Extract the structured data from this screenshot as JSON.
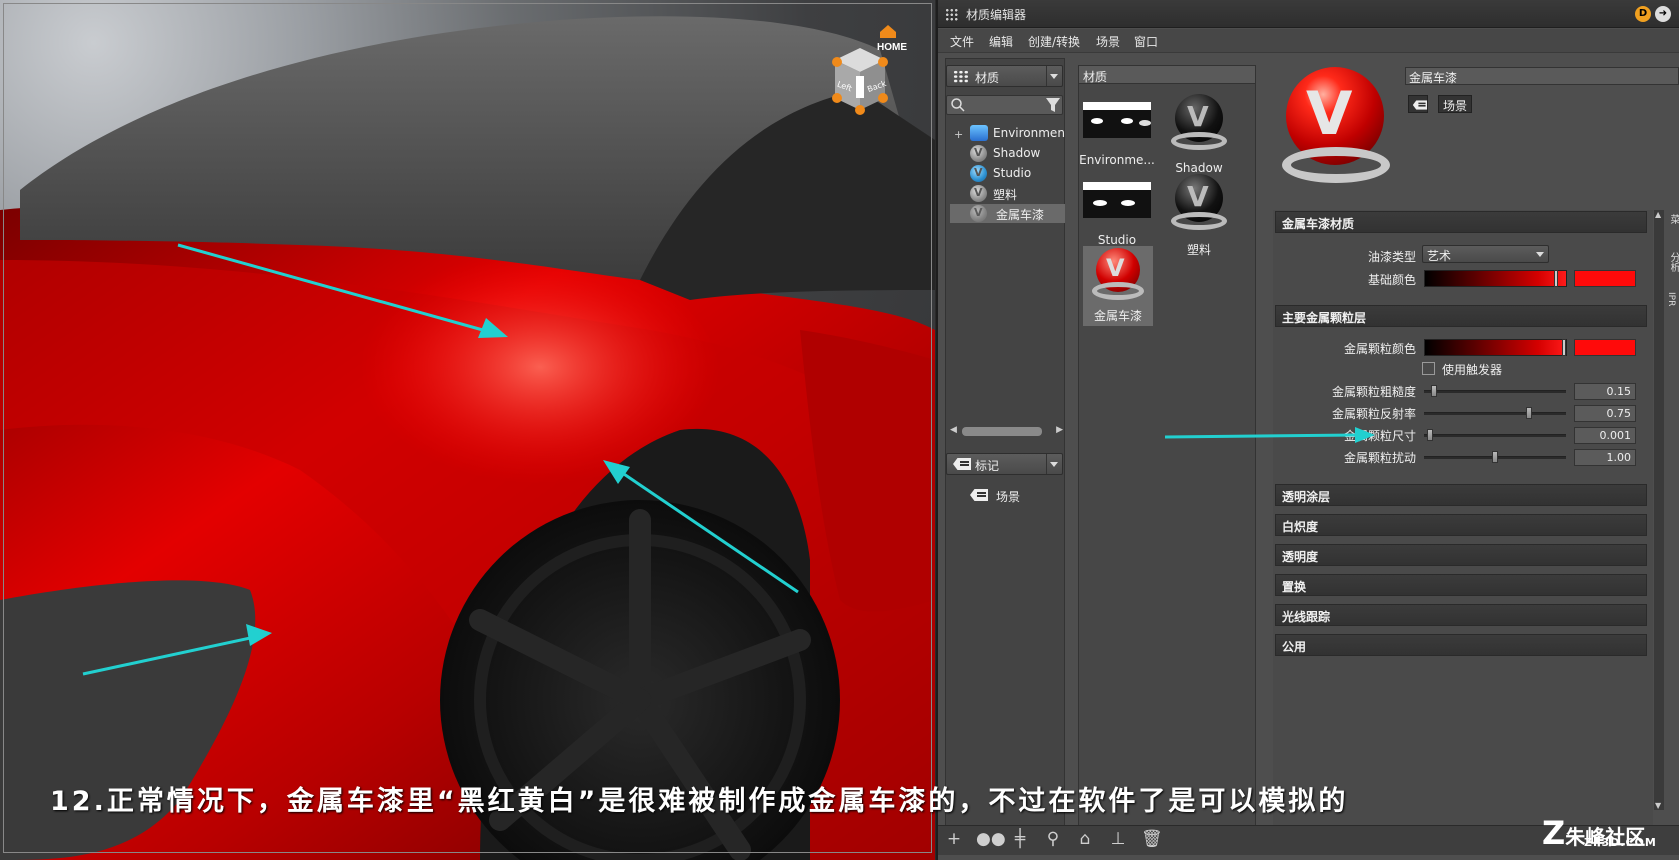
{
  "editor": {
    "title": "材质编辑器",
    "menu": [
      "文件",
      "编辑",
      "创建/转换",
      "场景",
      "窗口"
    ]
  },
  "left_panel": {
    "library_combo": "材质",
    "tree": [
      "Environmen",
      "Shadow",
      "Studio",
      "塑料",
      "金属车漆"
    ],
    "tag_combo": "标记",
    "tag_item": "场景"
  },
  "materials_panel": {
    "header": "材质",
    "thumbs": [
      "Environme...",
      "Shadow",
      "Studio",
      "塑料",
      "金属车漆"
    ]
  },
  "preview": {
    "name_field": "金属车漆",
    "scene_tag": "场景"
  },
  "sections": {
    "metallic_paint": {
      "title": "金属车漆材质",
      "paint_type_label": "油漆类型",
      "paint_type_value": "艺术",
      "base_color_label": "基础颜色"
    },
    "main_flakes": {
      "title": "主要金属颗粒层",
      "flake_color_label": "金属颗粒颜色",
      "use_trigger_label": "使用触发器",
      "sliders": [
        {
          "label": "金属颗粒粗糙度",
          "value": "0.15",
          "fraction": 0.05
        },
        {
          "label": "金属颗粒反射率",
          "value": "0.75",
          "fraction": 0.75
        },
        {
          "label": "金属颗粒尺寸",
          "value": "0.001",
          "fraction": 0.02
        },
        {
          "label": "金属颗粒扰动",
          "value": "1.00",
          "fraction": 0.5
        }
      ]
    },
    "collapsed": [
      "透明涂层",
      "白炽度",
      "透明度",
      "置换",
      "光线跟踪",
      "公用"
    ]
  },
  "side_tabs": [
    "菜",
    "分析",
    "IPR"
  ],
  "viewport": {
    "navcube_home": "HOME",
    "navcube_left": "Left",
    "navcube_back": "Back"
  },
  "caption": "12.正常情况下，金属车漆里“黑红黄白”是很难被制作成金属车漆的，不过在软件了是可以模拟的",
  "watermark": {
    "main": "朱峰社区",
    "sub": "ZF3D.COM"
  },
  "colors": {
    "car_paint": "#e00000",
    "base_color_swatch": "#ff0a0a",
    "arrow": "#22d0d0"
  }
}
